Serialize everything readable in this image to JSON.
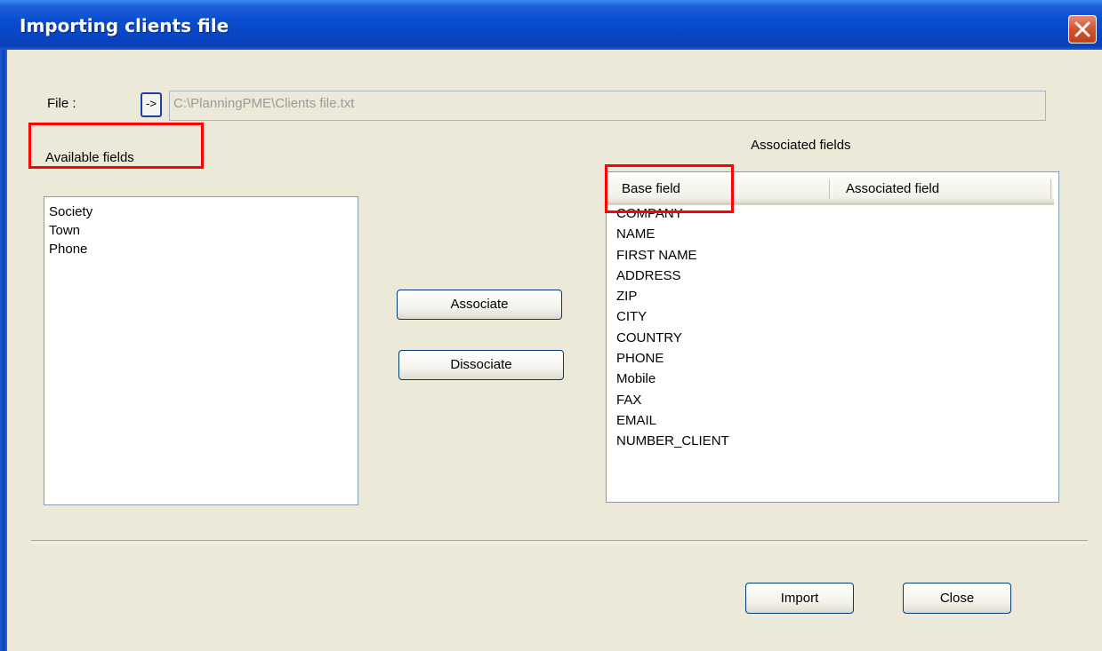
{
  "window": {
    "title": "Importing clients file"
  },
  "file": {
    "label": "File :",
    "browse_label": "->",
    "path": "C:\\PlanningPME\\Clients file.txt"
  },
  "available": {
    "label": "Available fields",
    "items": [
      "Society",
      "Town",
      "Phone"
    ]
  },
  "actions": {
    "associate": "Associate",
    "dissociate": "Dissociate"
  },
  "associated": {
    "label": "Associated fields",
    "columns": [
      "Base field",
      "Associated field"
    ],
    "rows": [
      "COMPANY",
      "NAME",
      "FIRST NAME",
      "ADDRESS",
      "ZIP",
      "CITY",
      "COUNTRY",
      "PHONE",
      "Mobile",
      "FAX",
      "EMAIL",
      "NUMBER_CLIENT"
    ]
  },
  "footer": {
    "import": "Import",
    "close": "Close"
  },
  "colors": {
    "titlebar": "#0a4ed0",
    "dialog_bg": "#ece9d8",
    "highlight": "#ff0000"
  }
}
